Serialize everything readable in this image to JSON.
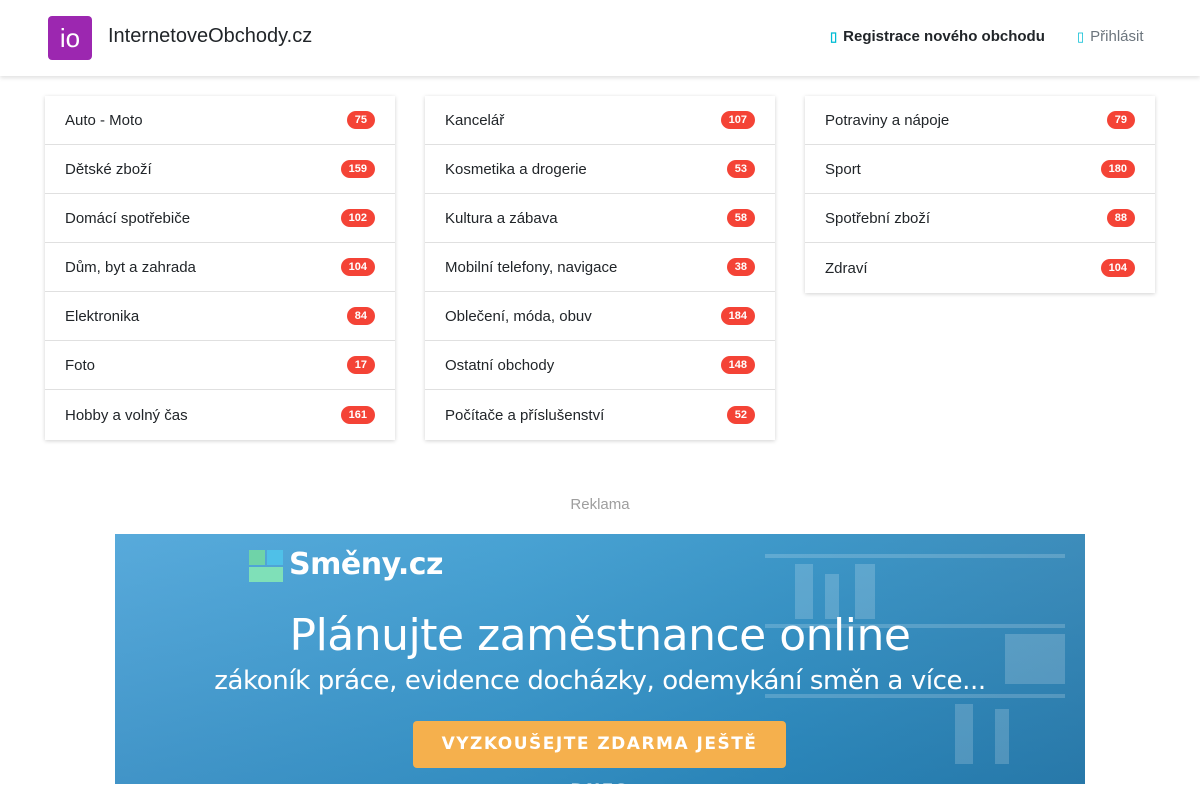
{
  "header": {
    "logo_text": "io",
    "brand": "InternetoveObchody.cz",
    "register_label": "Registrace nového obchodu",
    "login_label": "Přihlásit"
  },
  "categories": {
    "col1": [
      {
        "label": "Auto - Moto",
        "count": "75"
      },
      {
        "label": "Dětské zboží",
        "count": "159"
      },
      {
        "label": "Domácí spotřebiče",
        "count": "102"
      },
      {
        "label": "Dům, byt a zahrada",
        "count": "104"
      },
      {
        "label": "Elektronika",
        "count": "84"
      },
      {
        "label": "Foto",
        "count": "17"
      },
      {
        "label": "Hobby a volný čas",
        "count": "161"
      }
    ],
    "col2": [
      {
        "label": "Kancelář",
        "count": "107"
      },
      {
        "label": "Kosmetika a drogerie",
        "count": "53"
      },
      {
        "label": "Kultura a zábava",
        "count": "58"
      },
      {
        "label": "Mobilní telefony, navigace",
        "count": "38"
      },
      {
        "label": "Oblečení, móda, obuv",
        "count": "184"
      },
      {
        "label": "Ostatní obchody",
        "count": "148"
      },
      {
        "label": "Počítače a příslušenství",
        "count": "52"
      }
    ],
    "col3": [
      {
        "label": "Potraviny a nápoje",
        "count": "79"
      },
      {
        "label": "Sport",
        "count": "180"
      },
      {
        "label": "Spotřební zboží",
        "count": "88"
      },
      {
        "label": "Zdraví",
        "count": "104"
      }
    ]
  },
  "ad": {
    "label": "Reklama",
    "banner_brand": "Směny.cz",
    "headline": "Plánujte zaměstnance online",
    "subline": "zákoník práce, evidence docházky, odemykání směn a více...",
    "cta": "VYZKOUŠEJTE ZDARMA JEŠTĚ DNES"
  },
  "colors": {
    "logo_bg": "#9c27b0",
    "badge": "#f44336",
    "nav_icon": "#00bcd4",
    "cta": "#f5b04d"
  },
  "icons": {
    "register": "store-icon",
    "login": "sign-in-icon"
  }
}
